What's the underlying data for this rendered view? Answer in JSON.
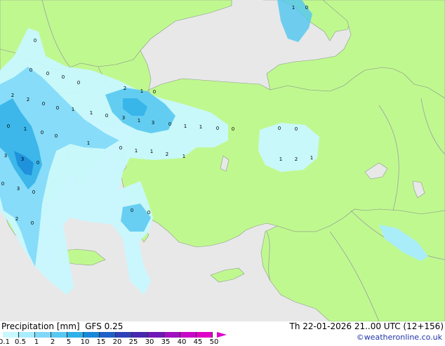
{
  "title": {
    "product": "Precipitation [mm]",
    "model": "GFS 0.25",
    "valid_time": "Th 22-01-2026 21..00 UTC (12+156)",
    "credit": "©weatheronline.co.uk"
  },
  "legend": {
    "ticks": [
      "0.1",
      "0.5",
      "1",
      "2",
      "5",
      "10",
      "15",
      "20",
      "25",
      "30",
      "35",
      "40",
      "45",
      "50"
    ],
    "colors": [
      "#c8f8ff",
      "#a8ecff",
      "#80d8f8",
      "#58c8f0",
      "#30b0e8",
      "#1888d8",
      "#2060c8",
      "#3040b8",
      "#4828b0",
      "#7018b8",
      "#a010c0",
      "#c808c8",
      "#e000c8"
    ]
  },
  "map_colors": {
    "sea": "#e8e8e8",
    "land": "#c0f890",
    "border": "#9aa0a0"
  },
  "precip_labels": [
    "1",
    "0",
    "0",
    "0",
    "0",
    "0",
    "0",
    "2",
    "1",
    "0",
    "2",
    "2",
    "0",
    "0",
    "1",
    "1",
    "0",
    "3",
    "1",
    "3",
    "0",
    "1",
    "1",
    "0",
    "0",
    "0",
    "0",
    "0",
    "1",
    "0",
    "0",
    "1",
    "0",
    "3",
    "3",
    "0",
    "1",
    "1",
    "2",
    "1",
    "1",
    "2",
    "1",
    "0",
    "3",
    "0",
    "2",
    "0",
    "0",
    "0"
  ]
}
